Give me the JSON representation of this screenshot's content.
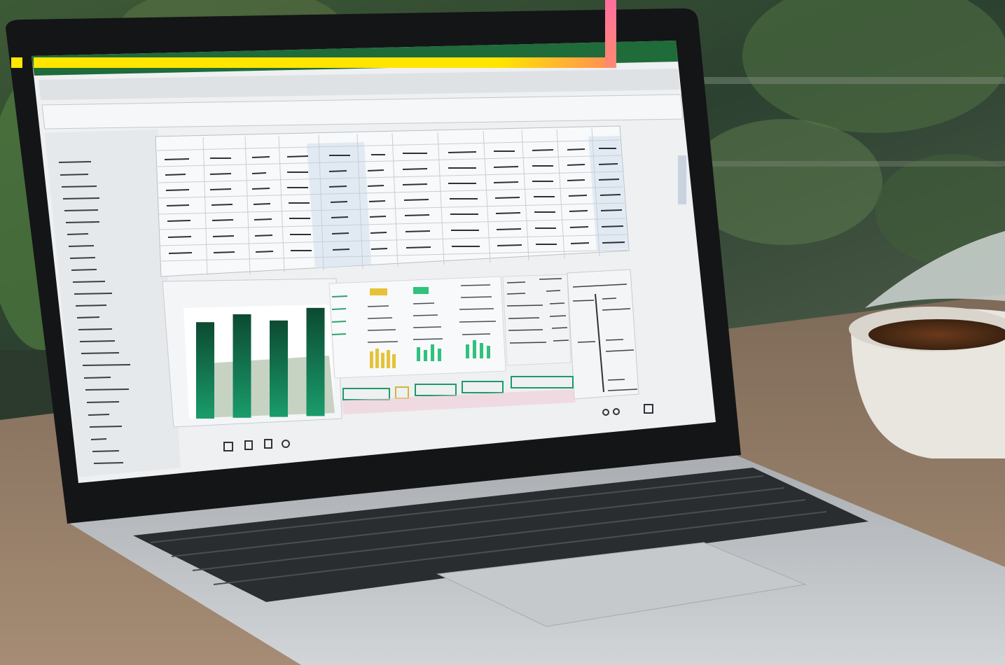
{
  "scene": {
    "description_colors": {
      "background_foliage": "#2f4a2e",
      "table_wood": "#8f7660",
      "laptop_body": "#b8bcc0",
      "screen_bezel": "#141516",
      "app_ribbon": "#1f6b3a",
      "sheet_bg": "#eef0f2",
      "chart_bar": "#0d5c3b",
      "accent_yellow": "#ffe500",
      "accent_pink": "#ff6fa0"
    },
    "chart_data": {
      "type": "bar",
      "categories": [
        "",
        "",
        "",
        ""
      ],
      "values": [
        82,
        88,
        82,
        92
      ],
      "ylim": [
        0,
        100
      ]
    }
  }
}
